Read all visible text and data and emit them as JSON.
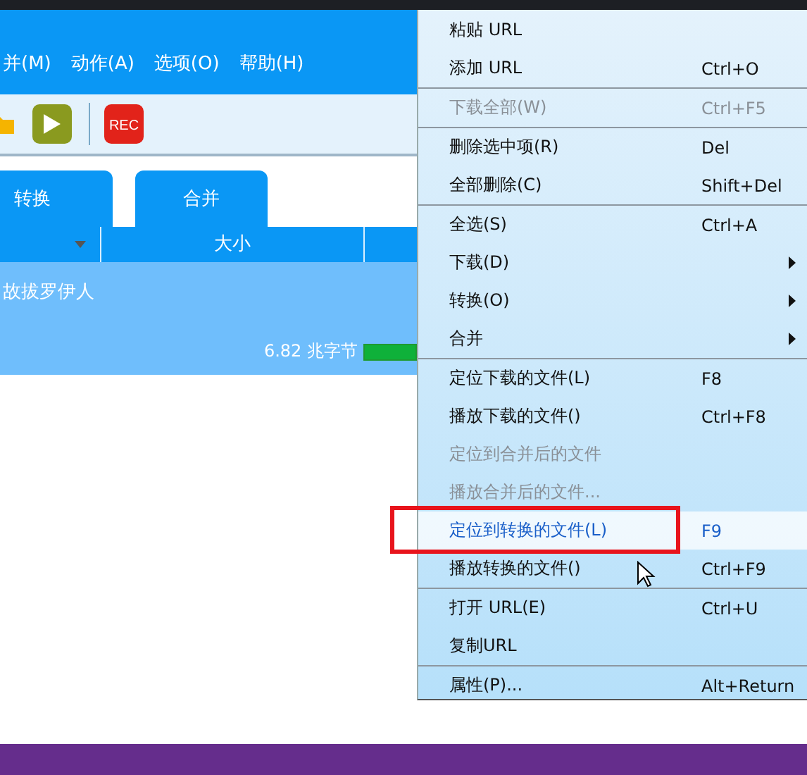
{
  "menu_bar": [
    "并(M)",
    "动作(A)",
    "选项(O)",
    "帮助(H)"
  ],
  "toolbar": {
    "record_label": "REC"
  },
  "tabs": [
    {
      "label": "转换"
    },
    {
      "label": "合并"
    }
  ],
  "table": {
    "columns": [
      "大小"
    ],
    "rows": [
      {
        "name": "故拔罗伊人",
        "size": "6.82 兆字节",
        "level": 1
      }
    ]
  },
  "context_menu": {
    "groups": [
      [
        {
          "label": "粘贴 URL",
          "disabled": false,
          "submenu": false,
          "selected": false
        },
        {
          "label": "添加 URL",
          "shortcut": "Ctrl+O",
          "disabled": false,
          "submenu": false,
          "selected": false
        }
      ],
      [
        {
          "label": "下载全部(W)",
          "shortcut": "Ctrl+F5",
          "disabled": true,
          "submenu": false,
          "selected": false
        }
      ],
      [
        {
          "label": "删除选中项(R)",
          "shortcut": "Del",
          "disabled": false,
          "submenu": false,
          "selected": false
        },
        {
          "label": "全部删除(C)",
          "shortcut": "Shift+Del",
          "disabled": false,
          "submenu": false,
          "selected": false
        }
      ],
      [
        {
          "label": "全选(S)",
          "shortcut": "Ctrl+A",
          "disabled": false,
          "submenu": false,
          "selected": false
        },
        {
          "label": "下载(D)",
          "disabled": false,
          "submenu": true,
          "selected": false
        },
        {
          "label": "转换(O)",
          "disabled": false,
          "submenu": true,
          "selected": false
        },
        {
          "label": "合并",
          "disabled": false,
          "submenu": true,
          "selected": false
        }
      ],
      [
        {
          "label": "定位下载的文件(L)",
          "shortcut": "F8",
          "disabled": false,
          "submenu": false,
          "selected": false
        },
        {
          "label": "播放下载的文件()",
          "shortcut": "Ctrl+F8",
          "disabled": false,
          "submenu": false,
          "selected": false
        },
        {
          "label": "定位到合并后的文件",
          "disabled": true,
          "submenu": false,
          "selected": false
        },
        {
          "label": "播放合并后的文件...",
          "disabled": true,
          "submenu": false,
          "selected": false
        },
        {
          "label": "定位到转换的文件(L)",
          "shortcut": "F9",
          "disabled": false,
          "submenu": false,
          "selected": true
        },
        {
          "label": "播放转换的文件()",
          "shortcut": "Ctrl+F9",
          "disabled": false,
          "submenu": false,
          "selected": false
        }
      ],
      [
        {
          "label": "打开 URL(E)",
          "shortcut": "Ctrl+U",
          "disabled": false,
          "submenu": false,
          "selected": false
        },
        {
          "label": "复制URL",
          "disabled": false,
          "submenu": false,
          "selected": false
        }
      ],
      [
        {
          "label": "属性(P)...",
          "shortcut": "Alt+Return",
          "disabled": false,
          "submenu": false,
          "selected": false
        }
      ]
    ]
  }
}
